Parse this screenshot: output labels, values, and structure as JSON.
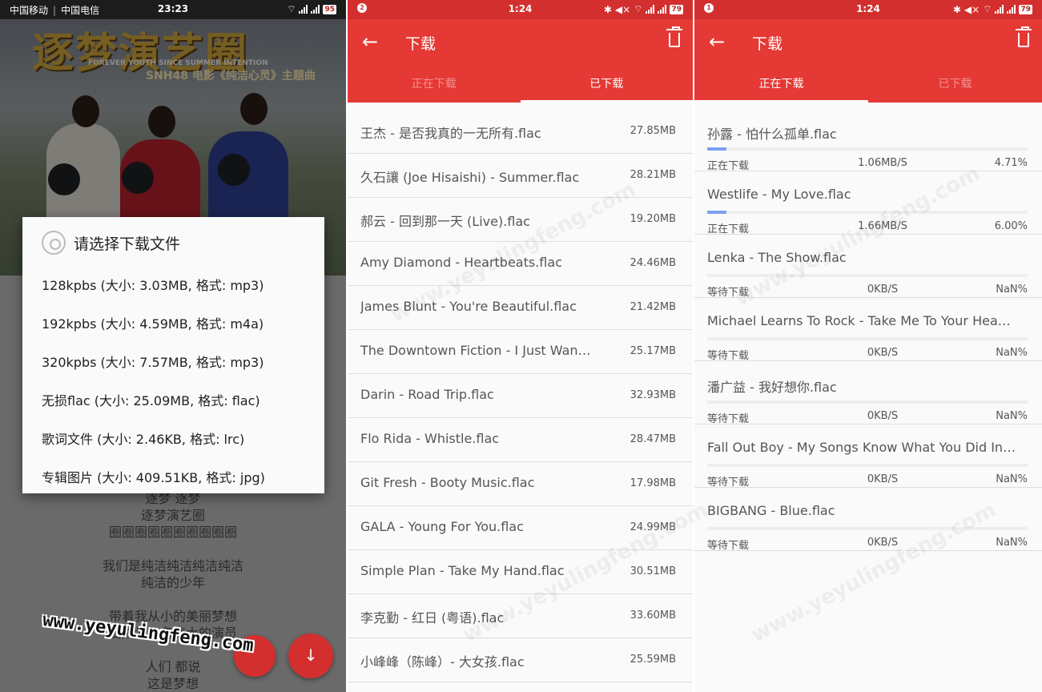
{
  "left_screen": {
    "status": {
      "carrier1": "中国移动",
      "carrier2": "中国电信",
      "time": "23:23",
      "battery": "95"
    },
    "poster": {
      "title": "逐梦演艺圈",
      "subtitle_en": "FOREVER YOUTH SINCE SUMMER INTENTION",
      "subtitle_cn": "SNH48  电影《纯洁心灵》主题曲"
    },
    "dialog": {
      "title": "请选择下载文件",
      "options": [
        "128kpbs (大小: 3.03MB, 格式: mp3)",
        "192kpbs (大小: 4.59MB, 格式: m4a)",
        "320kpbs (大小: 7.57MB, 格式: mp3)",
        "无损flac (大小: 25.09MB, 格式: flac)",
        "歌词文件 (大小: 2.46KB, 格式: lrc)",
        "专辑图片 (大小: 409.51KB, 格式: jpg)"
      ]
    },
    "lyrics": [
      "逐梦 逐梦",
      "逐梦演艺圈",
      "圈圈圈圈圈圈圈圈圈圈",
      "",
      "我们是纯洁纯洁纯洁纯洁",
      "纯洁的少年",
      "",
      "带着我从小的美丽梦想",
      "要成为一名伟大的演员",
      "",
      "人们 都说",
      "这是梦想"
    ],
    "watermark": "www.yeyulingfeng.com"
  },
  "middle_screen": {
    "status": {
      "notif": "2",
      "time": "1:24",
      "battery": "79"
    },
    "toolbar_title": "下载",
    "tabs": [
      "正在下载",
      "已下载"
    ],
    "active_tab": 1,
    "files": [
      {
        "name": "王杰 - 是否我真的一无所有.flac",
        "size": "27.85MB"
      },
      {
        "name": "久石讓 (Joe Hisaishi) - Summer.flac",
        "size": "28.21MB"
      },
      {
        "name": "郝云 - 回到那一天 (Live).flac",
        "size": "19.20MB"
      },
      {
        "name": "Amy Diamond - Heartbeats.flac",
        "size": "24.46MB"
      },
      {
        "name": "James Blunt - You're Beautiful.flac",
        "size": "21.42MB"
      },
      {
        "name": "The Downtown Fiction - I Just Wan…",
        "size": "25.17MB"
      },
      {
        "name": "Darin - Road Trip.flac",
        "size": "32.93MB"
      },
      {
        "name": "Flo Rida - Whistle.flac",
        "size": "28.47MB"
      },
      {
        "name": "Git Fresh - Booty Music.flac",
        "size": "17.98MB"
      },
      {
        "name": "GALA - Young For You.flac",
        "size": "24.99MB"
      },
      {
        "name": "Simple Plan - Take My Hand.flac",
        "size": "30.51MB"
      },
      {
        "name": "李克勤 - 红日 (粤语).flac",
        "size": "33.60MB"
      },
      {
        "name": "小峰峰（陈峰）- 大女孩.flac",
        "size": "25.59MB"
      }
    ]
  },
  "right_screen": {
    "status": {
      "notif": "1",
      "time": "1:24",
      "battery": "79"
    },
    "toolbar_title": "下载",
    "tabs": [
      "正在下载",
      "已下载"
    ],
    "active_tab": 0,
    "downloads": [
      {
        "name": "孙露 - 怕什么孤单.flac",
        "status": "正在下载",
        "speed": "1.06MB/S",
        "percent": "4.71%",
        "progress": 0.0471
      },
      {
        "name": "Westlife - My Love.flac",
        "status": "正在下载",
        "speed": "1.66MB/S",
        "percent": "6.00%",
        "progress": 0.06
      },
      {
        "name": "Lenka - The Show.flac",
        "status": "等待下载",
        "speed": "0KB/S",
        "percent": "NaN%",
        "progress": 0
      },
      {
        "name": "Michael Learns To Rock - Take Me To Your Hea…",
        "status": "等待下载",
        "speed": "0KB/S",
        "percent": "NaN%",
        "progress": 0
      },
      {
        "name": "潘广益 - 我好想你.flac",
        "status": "等待下载",
        "speed": "0KB/S",
        "percent": "NaN%",
        "progress": 0
      },
      {
        "name": "Fall Out Boy - My Songs Know What You Did In…",
        "status": "等待下载",
        "speed": "0KB/S",
        "percent": "NaN%",
        "progress": 0
      },
      {
        "name": "BIGBANG - Blue.flac",
        "status": "等待下载",
        "speed": "0KB/S",
        "percent": "NaN%",
        "progress": 0
      }
    ]
  },
  "colors": {
    "primary": "#e53935",
    "progress": "#7ea0ef"
  }
}
